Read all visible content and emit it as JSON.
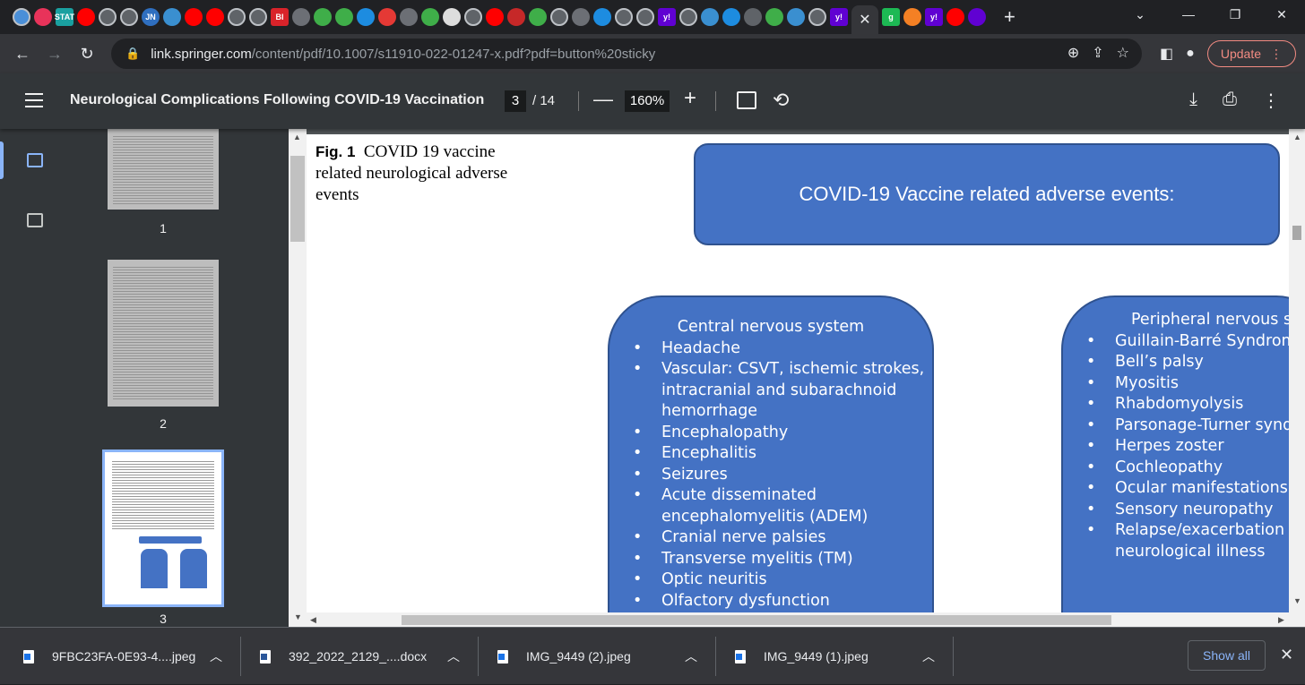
{
  "browser": {
    "tabs": [
      {
        "icon": "globe-icon",
        "color": "#4a8fd8",
        "text": ""
      },
      {
        "icon": "pinwheel-icon",
        "color": "#e8335a",
        "text": ""
      },
      {
        "icon": "stat-icon",
        "color": "#1aa0a0",
        "text": "STAT"
      },
      {
        "icon": "youtube-icon",
        "color": "#ff0000",
        "text": ""
      },
      {
        "icon": "globe-icon",
        "color": "#5f6368",
        "text": ""
      },
      {
        "icon": "globe-icon",
        "color": "#5f6368",
        "text": ""
      },
      {
        "icon": "jn-icon",
        "color": "#2f6fc0",
        "text": "JN"
      },
      {
        "icon": "caduceus-icon",
        "color": "#3a8fd0",
        "text": ""
      },
      {
        "icon": "youtube-icon",
        "color": "#ff0000",
        "text": ""
      },
      {
        "icon": "youtube-icon",
        "color": "#ff0000",
        "text": ""
      },
      {
        "icon": "globe-icon",
        "color": "#5f6368",
        "text": ""
      },
      {
        "icon": "globe-icon",
        "color": "#5f6368",
        "text": ""
      },
      {
        "icon": "bi-icon",
        "color": "#d9232a",
        "text": "BI"
      },
      {
        "icon": "play-icon",
        "color": "#6c6f75",
        "text": ""
      },
      {
        "icon": "play-icon",
        "color": "#3fae49",
        "text": ""
      },
      {
        "icon": "play-icon",
        "color": "#3fae49",
        "text": ""
      },
      {
        "icon": "c-icon",
        "color": "#1d8ce0",
        "text": ""
      },
      {
        "icon": "mic-icon",
        "color": "#e53935",
        "text": ""
      },
      {
        "icon": "play-icon",
        "color": "#6c6f75",
        "text": ""
      },
      {
        "icon": "play-icon",
        "color": "#3fae49",
        "text": ""
      },
      {
        "icon": "grid-icon",
        "color": "#dddddd",
        "text": ""
      },
      {
        "icon": "globe-icon",
        "color": "#5f6368",
        "text": ""
      },
      {
        "icon": "youtube-icon",
        "color": "#ff0000",
        "text": ""
      },
      {
        "icon": "scribble-icon",
        "color": "#c62828",
        "text": ""
      },
      {
        "icon": "play-icon",
        "color": "#3fae49",
        "text": ""
      },
      {
        "icon": "globe-icon",
        "color": "#5f6368",
        "text": ""
      },
      {
        "icon": "play-icon",
        "color": "#6c6f75",
        "text": ""
      },
      {
        "icon": "search-icon",
        "color": "#1d8ce0",
        "text": ""
      },
      {
        "icon": "globe-icon",
        "color": "#5f6368",
        "text": ""
      },
      {
        "icon": "globe-icon",
        "color": "#5f6368",
        "text": ""
      },
      {
        "icon": "yahoo-icon",
        "color": "#6001d2",
        "text": "y!"
      },
      {
        "icon": "globe-icon",
        "color": "#5f6368",
        "text": ""
      },
      {
        "icon": "caduceus-icon",
        "color": "#3a8fd0",
        "text": ""
      },
      {
        "icon": "search-icon",
        "color": "#1d8ce0",
        "text": ""
      },
      {
        "icon": "slash-icon",
        "color": "#5f6368",
        "text": ""
      },
      {
        "icon": "play-icon",
        "color": "#3fae49",
        "text": ""
      },
      {
        "icon": "caduceus-icon",
        "color": "#3a8fd0",
        "text": ""
      },
      {
        "icon": "globe-icon",
        "color": "#5f6368",
        "text": ""
      },
      {
        "icon": "yahoo-icon",
        "color": "#6001d2",
        "text": "y!"
      }
    ],
    "tabs_after_active": [
      {
        "icon": "g-icon",
        "color": "#1db954",
        "text": "g"
      },
      {
        "icon": "stack-icon",
        "color": "#f48024",
        "text": ""
      },
      {
        "icon": "yahoo-icon",
        "color": "#6001d2",
        "text": "y!"
      },
      {
        "icon": "youtube-icon",
        "color": "#ff0000",
        "text": ""
      },
      {
        "icon": "yahoo-mail-icon",
        "color": "#6001d2",
        "text": ""
      }
    ],
    "url_host": "link.springer.com",
    "url_path": "/content/pdf/10.1007/s11910-022-01247-x.pdf?pdf=button%20sticky",
    "update_label": "Update"
  },
  "pdf": {
    "title": "Neurological Complications Following COVID-19 Vaccination",
    "current_page": "3",
    "total_pages": "/ 14",
    "zoom": "160%",
    "thumbnails": [
      "1",
      "2",
      "3"
    ]
  },
  "figure": {
    "caption_label": "Fig. 1",
    "caption_text": "COVID 19 vaccine related neurological adverse events",
    "header": "COVID-19 Vaccine related adverse events:",
    "cns": {
      "title": "Central nervous system",
      "items": [
        "Headache",
        "Vascular: CSVT, ischemic strokes, intracranial and subarachnoid hemorrhage",
        "Encephalopathy",
        "Encephalitis",
        "Seizures",
        "Acute disseminated encephalomyelitis (ADEM)",
        "Cranial nerve palsies",
        "Transverse myelitis (TM)",
        "Optic neuritis",
        "Olfactory dysfunction"
      ]
    },
    "pns": {
      "title": "Peripheral nervous sys",
      "items": [
        "Guillain-Barré Syndrome",
        "Bell’s palsy",
        "Myositis",
        "Rhabdomyolysis",
        "Parsonage-Turner syndro",
        "Herpes zoster",
        "Cochleopathy",
        "Ocular manifestations",
        "Sensory neuropathy",
        "Relapse/exacerbation of neurological illness"
      ]
    },
    "panel_color": "#4472c4"
  },
  "downloads": {
    "items": [
      {
        "name": "9FBC23FA-0E93-4....jpeg",
        "type": "image"
      },
      {
        "name": "392_2022_2129_....docx",
        "type": "word"
      },
      {
        "name": "IMG_9449 (2).jpeg",
        "type": "image"
      },
      {
        "name": "IMG_9449 (1).jpeg",
        "type": "image"
      }
    ],
    "show_all": "Show all"
  }
}
